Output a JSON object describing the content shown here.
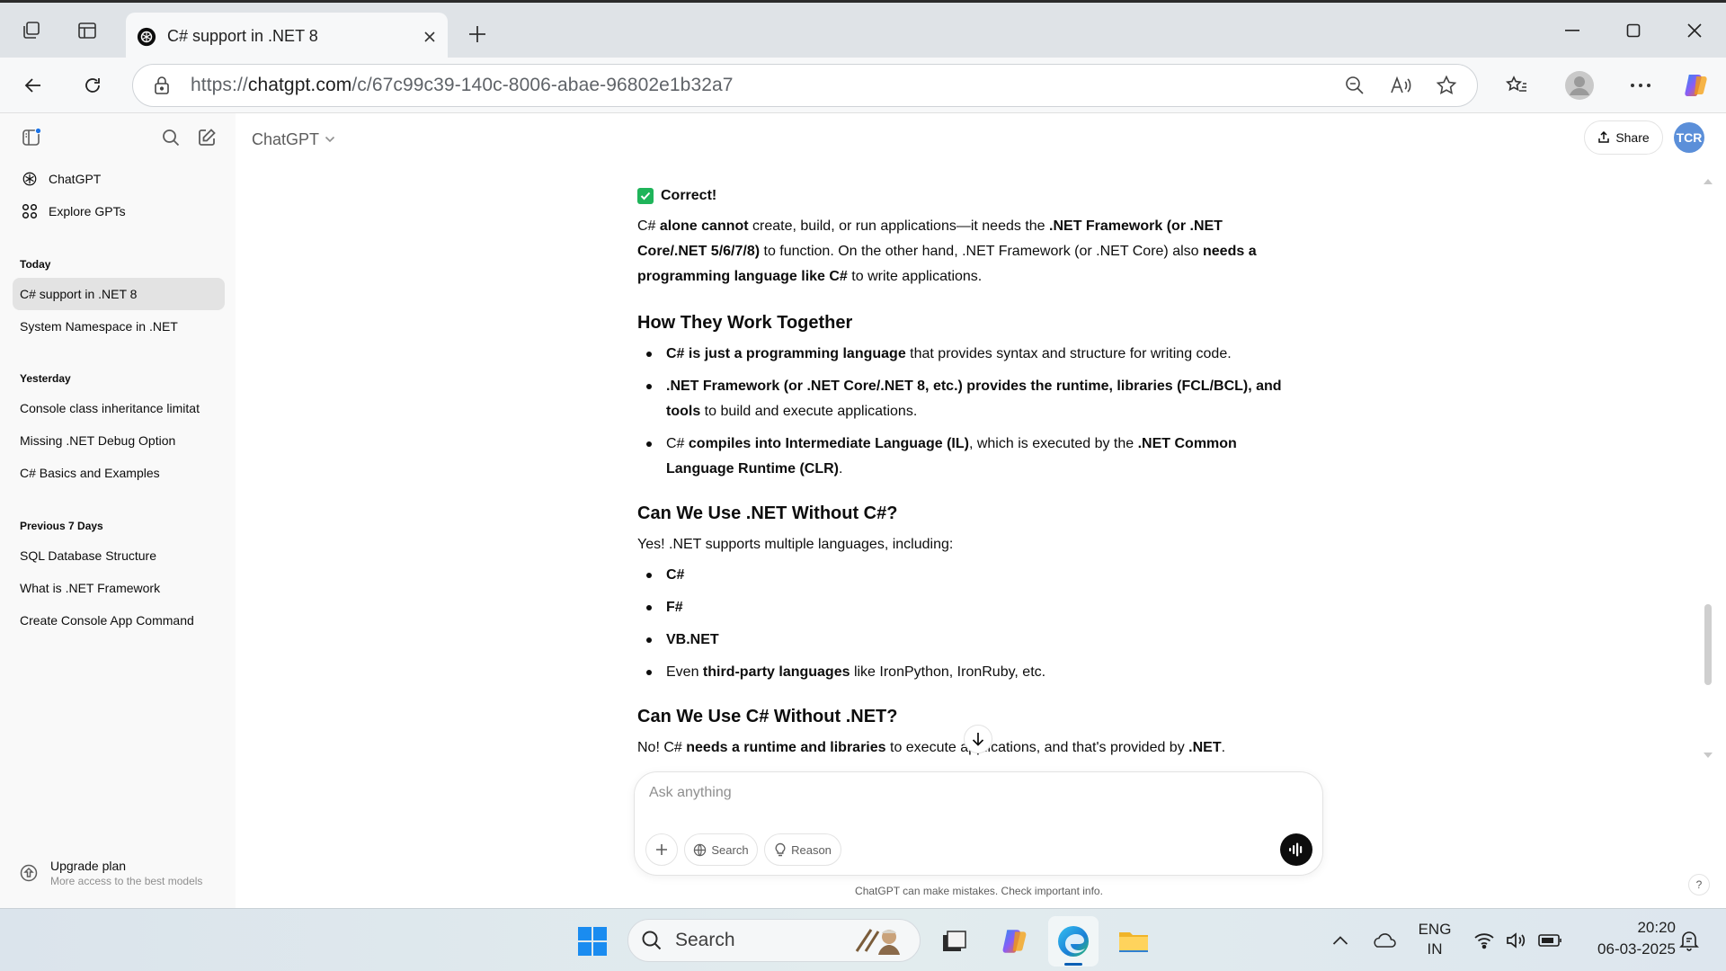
{
  "browser": {
    "tab_title": "C# support in .NET 8",
    "url_prefix": "https://",
    "url_domain": "chatgpt.com",
    "url_path": "/c/67c99c39-140c-8006-abae-96802e1b32a7"
  },
  "sidebar": {
    "nav": [
      {
        "label": "ChatGPT",
        "icon": "chatgpt-logo-icon"
      },
      {
        "label": "Explore GPTs",
        "icon": "grid-icon"
      }
    ],
    "sections": [
      {
        "heading": "Today",
        "items": [
          "C# support in .NET 8",
          "System Namespace in .NET"
        ]
      },
      {
        "heading": "Yesterday",
        "items": [
          "Console class inheritance limitat",
          "Missing .NET Debug Option",
          "C# Basics and Examples"
        ]
      },
      {
        "heading": "Previous 7 Days",
        "items": [
          "SQL Database Structure",
          "What is .NET Framework",
          "Create Console App Command"
        ]
      }
    ],
    "upgrade": {
      "title": "Upgrade plan",
      "subtitle": "More access to the best models"
    }
  },
  "header": {
    "model": "ChatGPT",
    "share_label": "Share",
    "avatar_initials": "TCR"
  },
  "message": {
    "correct_label": "Correct!",
    "p1": {
      "t1": "C# ",
      "b1": "alone cannot",
      "t2": " create, build, or run applications—it needs the ",
      "b2": ".NET Framework (or .NET Core/.NET 5/6/7/8)",
      "t3": " to function. On the other hand, .NET Framework (or .NET Core) also ",
      "b3": "needs a programming language like C#",
      "t4": " to write applications."
    },
    "h_together": "How They Work Together",
    "together": [
      {
        "b": "C# is just a programming language",
        "t": " that provides syntax and structure for writing code."
      },
      {
        "b": ".NET Framework (or .NET Core/.NET 8, etc.) provides the runtime, libraries (FCL/BCL), and tools",
        "t": " to build and execute applications."
      },
      {
        "t0": "C# ",
        "b": "compiles into Intermediate Language (IL)",
        "t": ", which is executed by the ",
        "b2": ".NET Common Language Runtime (CLR)",
        "t2": "."
      }
    ],
    "h_without_csharp": "Can We Use .NET Without C#?",
    "p2": "Yes! .NET supports multiple languages, including:",
    "languages": [
      "C#",
      "F#",
      "VB.NET"
    ],
    "lang_last": {
      "t0": "Even ",
      "b": "third-party languages",
      "t": " like IronPython, IronRuby, etc."
    },
    "h_without_net": "Can We Use C# Without .NET?",
    "p3": {
      "t0": "No! C# ",
      "b": "needs a runtime and libraries",
      "t": " to execute applications, and that's provided by ",
      "b2": ".NET",
      "t2": "."
    }
  },
  "composer": {
    "placeholder": "Ask anything",
    "search_label": "Search",
    "reason_label": "Reason",
    "disclaimer": "ChatGPT can make mistakes. Check important info.",
    "help": "?"
  },
  "taskbar": {
    "search_label": "Search",
    "lang_line1": "ENG",
    "lang_line2": "IN",
    "time": "20:20",
    "date": "06-03-2025"
  },
  "colors": {
    "accent_check": "#1fb45a",
    "avatar": "#5b8fd9",
    "active_item": "#e3e3e3"
  }
}
